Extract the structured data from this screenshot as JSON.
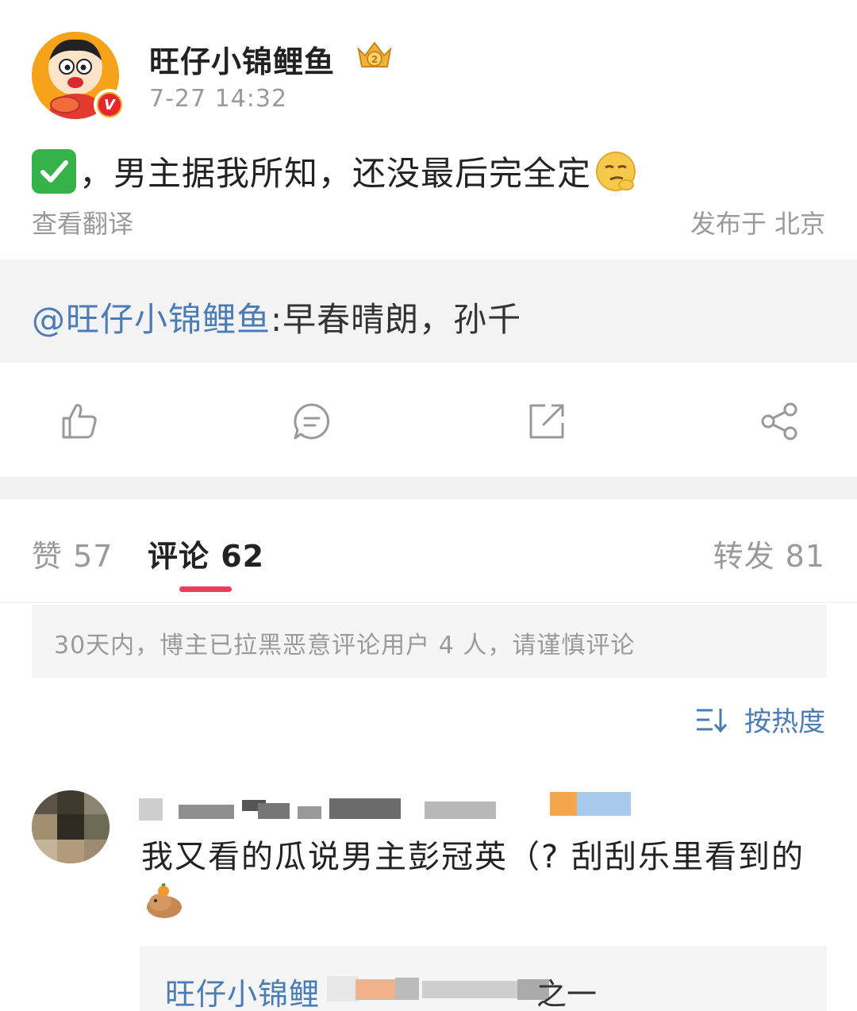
{
  "post": {
    "username": "旺仔小锦鲤鱼",
    "timestamp": "7-27 14:32",
    "text": "，男主据我所知，还没最后完全定",
    "translate_label": "查看翻译",
    "location": "发布于 北京"
  },
  "quote": {
    "author": "@旺仔小锦鲤鱼",
    "text": ":早春晴朗，孙千"
  },
  "actions": {
    "like_icon": "thumbs-up-icon",
    "comment_icon": "comment-bubble-icon",
    "repost_icon": "external-share-icon",
    "share_icon": "share-nodes-icon"
  },
  "tabs": {
    "likes": "赞 57",
    "comments": "评论 62",
    "reposts": "转发 81"
  },
  "notice": "30天内，博主已拉黑恶意评论用户 4 人，请谨慎评论",
  "sort_label": "按热度",
  "comment": {
    "text": "我又看的瓜说男主彭冠英（? 刮刮乐里看到的",
    "reply_author": "旺仔小锦鲤",
    "reply_tail": "之一"
  },
  "colors": {
    "link": "#4b7cb6",
    "accent": "#eb3d5b",
    "muted": "#9a9a9a"
  }
}
